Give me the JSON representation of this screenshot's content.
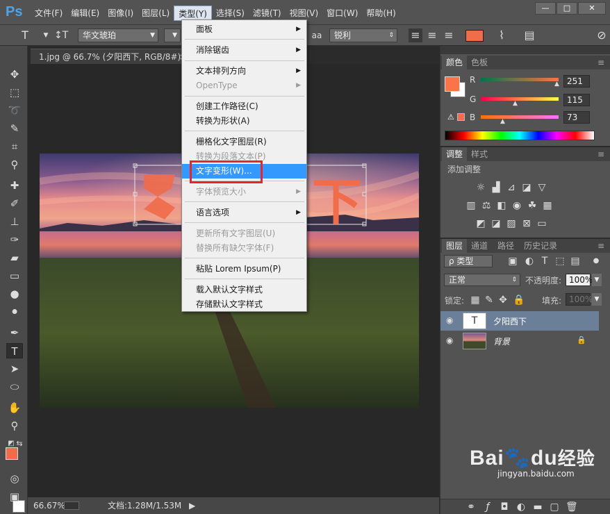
{
  "app": {
    "logo": "Ps"
  },
  "menubar": {
    "items": [
      "文件(F)",
      "编辑(E)",
      "图像(I)",
      "图层(L)",
      "类型(Y)",
      "选择(S)",
      "滤镜(T)",
      "视图(V)",
      "窗口(W)",
      "帮助(H)"
    ],
    "active_index": 4,
    "minimize": "—",
    "maximize": "□",
    "close": "✕"
  },
  "options": {
    "font_family": "华文琥珀",
    "antialias_icon_label": "aa",
    "antialias": "锐利",
    "text_color": "#f06c4a"
  },
  "document": {
    "tab_title": "1.jpg @ 66.7% (夕阳西下, RGB/8#) *",
    "tab_close": "×",
    "zoom": "66.67%",
    "doc_info": "文档:1.28M/1.53M"
  },
  "type_menu": {
    "items": [
      {
        "label": "面板",
        "submenu": true,
        "disabled": false
      },
      {
        "label": "消除锯齿",
        "submenu": true,
        "disabled": false
      },
      {
        "label": "文本排列方向",
        "submenu": true,
        "disabled": false
      },
      {
        "label": "OpenType",
        "submenu": true,
        "disabled": true
      },
      {
        "label": "创建工作路径(C)",
        "submenu": false,
        "disabled": false
      },
      {
        "label": "转换为形状(A)",
        "submenu": false,
        "disabled": false
      },
      {
        "label": "栅格化文字图层(R)",
        "submenu": false,
        "disabled": false
      },
      {
        "label": "转换为段落文本(P)",
        "submenu": false,
        "disabled": true
      },
      {
        "label": "文字变形(W)...",
        "submenu": false,
        "disabled": false,
        "highlighted": true
      },
      {
        "label": "字体预览大小",
        "submenu": true,
        "disabled": true
      },
      {
        "label": "语言选项",
        "submenu": true,
        "disabled": false
      },
      {
        "label": "更新所有文字图层(U)",
        "submenu": false,
        "disabled": true
      },
      {
        "label": "替换所有缺欠字体(F)",
        "submenu": false,
        "disabled": true
      },
      {
        "label": "粘贴 Lorem Ipsum(P)",
        "submenu": false,
        "disabled": false
      },
      {
        "label": "载入默认文字样式",
        "submenu": false,
        "disabled": false
      },
      {
        "label": "存储默认文字样式",
        "submenu": false,
        "disabled": false
      }
    ]
  },
  "color_panel": {
    "tabs": [
      "颜色",
      "色板"
    ],
    "r_label": "R",
    "g_label": "G",
    "b_label": "B",
    "r": "251",
    "g": "115",
    "b": "73",
    "fg": "#fb7349"
  },
  "adjust_panel": {
    "tabs": [
      "调整",
      "样式"
    ],
    "hint": "添加调整"
  },
  "layers_panel": {
    "tabs": [
      "图层",
      "通道",
      "路径",
      "历史记录"
    ],
    "filter_label": "ρ 类型",
    "blend_mode": "正常",
    "opacity_label": "不透明度:",
    "opacity": "100%",
    "lock_label": "锁定:",
    "fill_label": "填充:",
    "fill": "100%",
    "layers": [
      {
        "name": "夕阳西下",
        "type": "text",
        "selected": true
      },
      {
        "name": "背景",
        "type": "image",
        "selected": false,
        "locked": true
      }
    ]
  },
  "canvas_text": {
    "visible_glyph": "下"
  },
  "watermark": {
    "brand_a": "Bai",
    "brand_b": "du",
    "brand_c": "经验",
    "url": "jingyan.baidu.com"
  }
}
